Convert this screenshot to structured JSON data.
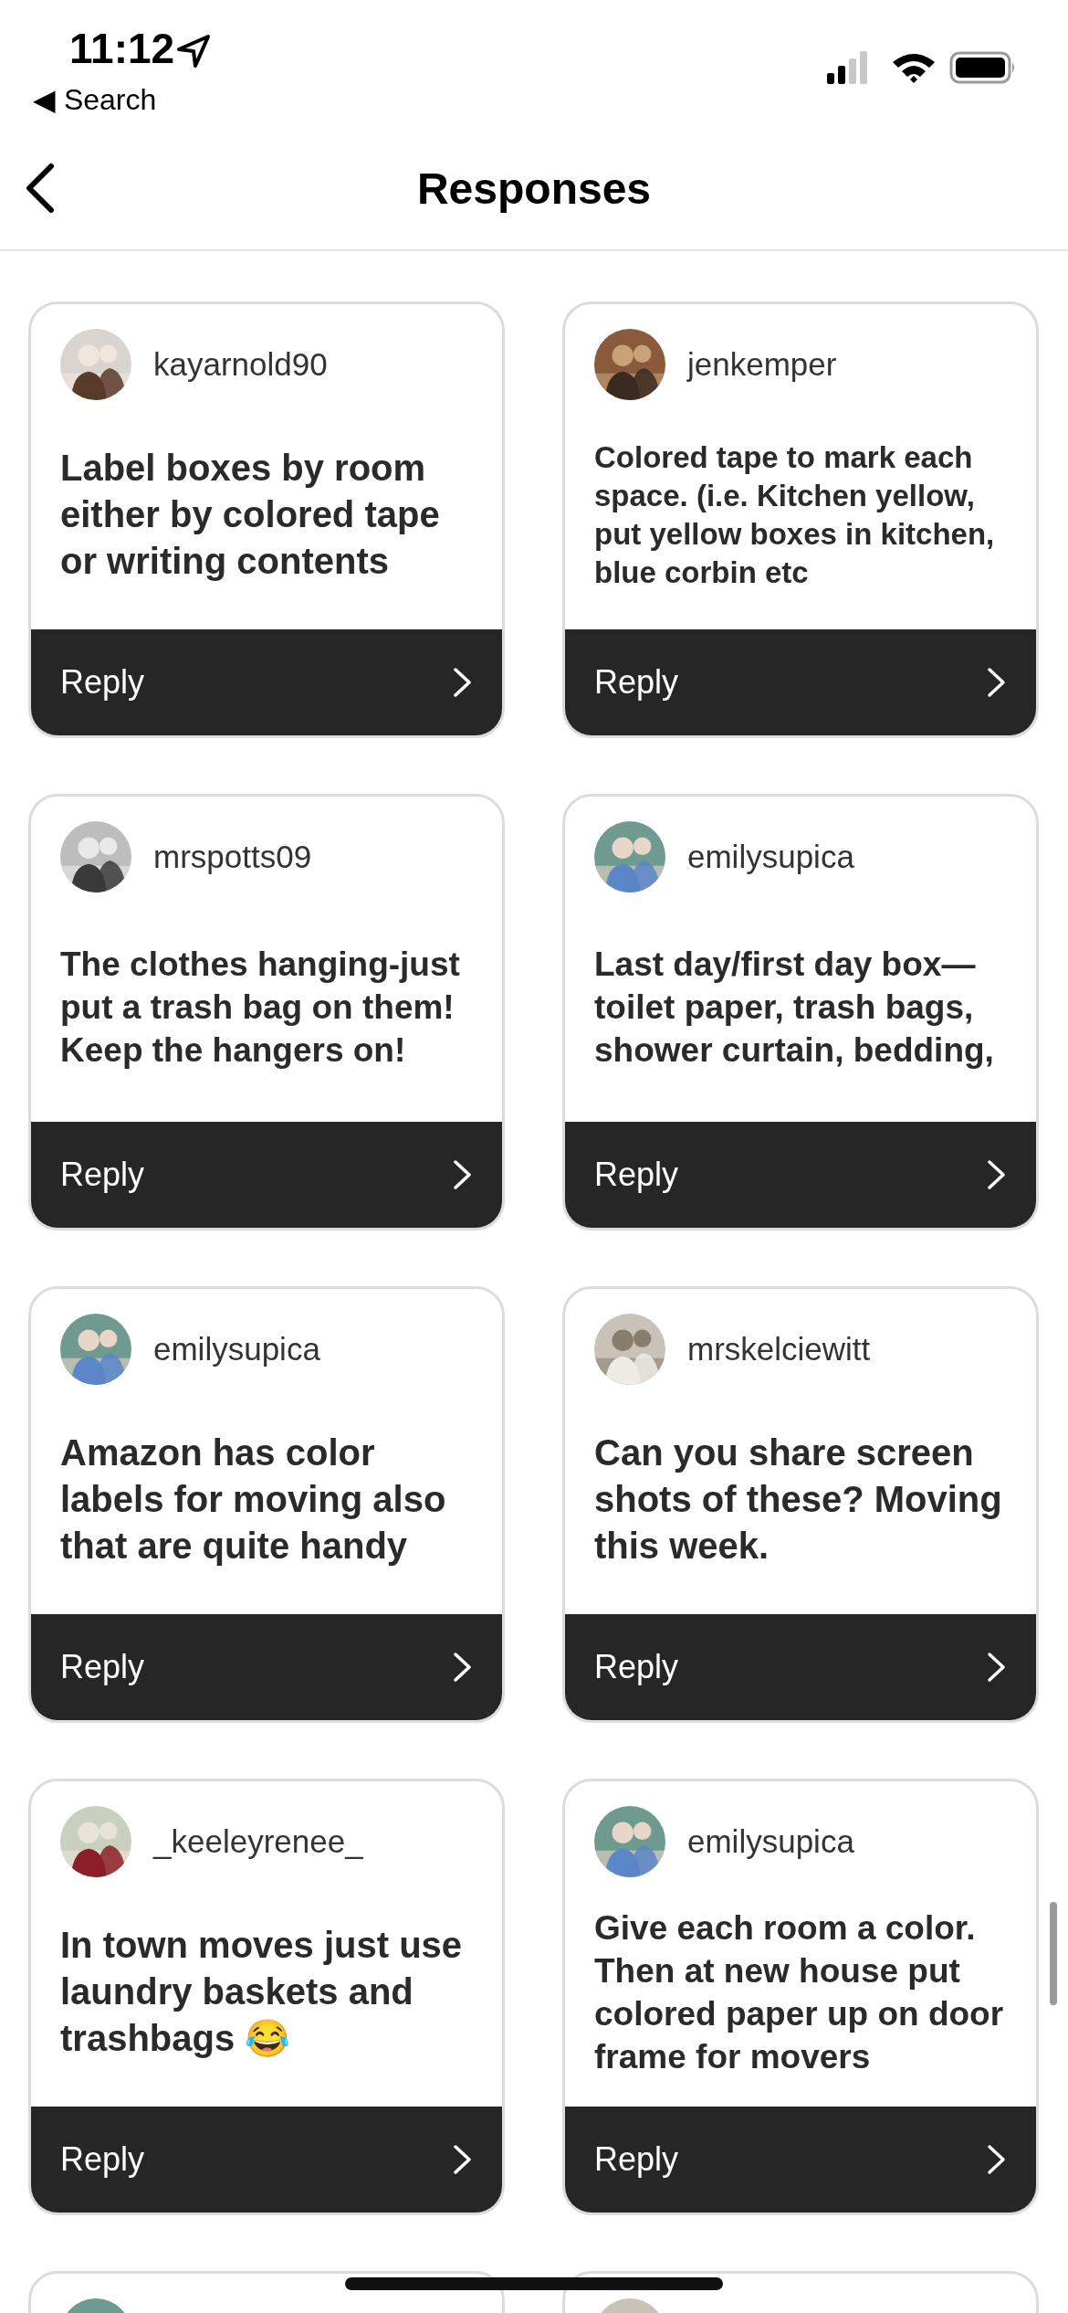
{
  "status_bar": {
    "time": "11:12",
    "back_label": "◀ Search"
  },
  "nav": {
    "title": "Responses"
  },
  "responses": [
    {
      "kind": "large_text",
      "username": "kayarnold90",
      "text": "Label boxes by room either by colored tape or writing contents",
      "reply": "Reply"
    },
    {
      "kind": "small_text",
      "username": "jenkemper",
      "text": "Colored tape to mark each space. (i.e. Kitchen yellow, put yellow boxes in kitchen, blue corbin etc",
      "reply": "Reply"
    },
    {
      "kind": "medium_text",
      "username": "mrspotts09",
      "text": "The clothes hanging-just put a trash bag on them! Keep the hangers on!",
      "reply": "Reply"
    },
    {
      "kind": "medium_text",
      "username": "emilysupica",
      "text": "Last day/first day box—toilet paper, trash bags, shower curtain, bedding,",
      "reply": "Reply"
    },
    {
      "kind": "large_text",
      "username": "emilysupica",
      "text": "Amazon has color labels for moving also that are quite handy",
      "reply": "Reply"
    },
    {
      "kind": "large_text",
      "username": "mrskelciewitt",
      "text": "Can you share screen shots of these? Moving this week.",
      "reply": "Reply"
    },
    {
      "kind": "large_text",
      "username": "_keeleyrenee_",
      "text": "In town moves just use laundry baskets and trashbags 😂",
      "reply": "Reply"
    },
    {
      "kind": "medium_text",
      "username": "emilysupica",
      "text": "Give each room a color. Then at new house put colored paper up on door frame for movers",
      "reply": "Reply"
    },
    {
      "kind": "cut_off"
    },
    {
      "kind": "cut_off"
    }
  ]
}
